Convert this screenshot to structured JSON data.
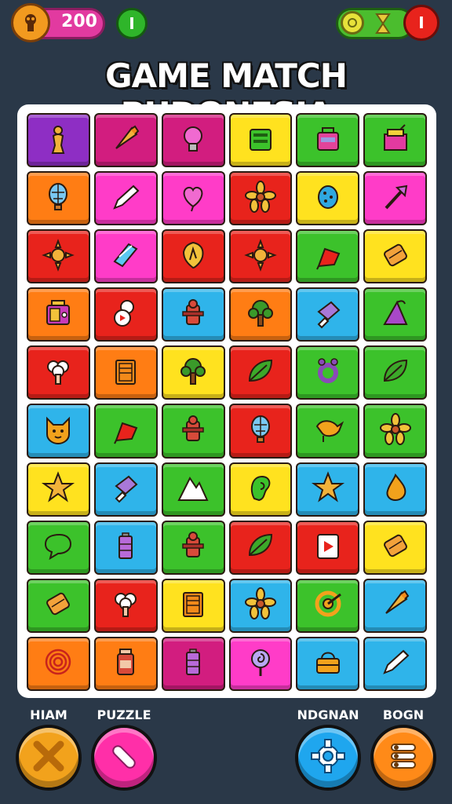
{
  "header": {
    "coins": "200",
    "left_info_label": "I",
    "right_info_label": "I"
  },
  "title": "GAME MATCH PUDONESIA",
  "colors": {
    "purple": "#8e2ec4",
    "magenta": "#d21d7f",
    "pink": "#ff3cc8",
    "yellow": "#ffe21f",
    "green": "#3cc22b",
    "orange": "#ff7d14",
    "red": "#e8231c",
    "blue": "#2fb4ea"
  },
  "board": {
    "rows": [
      [
        {
          "c": "purple",
          "i": "figure-icon"
        },
        {
          "c": "magenta",
          "i": "cone-icon"
        },
        {
          "c": "magenta",
          "i": "bulb-icon"
        },
        {
          "c": "yellow",
          "i": "machine-icon"
        },
        {
          "c": "green",
          "i": "bag-icon"
        },
        {
          "c": "green",
          "i": "box-icon"
        }
      ],
      [
        {
          "c": "orange",
          "i": "balloon-icon"
        },
        {
          "c": "pink",
          "i": "pencil-icon"
        },
        {
          "c": "pink",
          "i": "heart-icon"
        },
        {
          "c": "red",
          "i": "flower-icon"
        },
        {
          "c": "yellow",
          "i": "egg-icon"
        },
        {
          "c": "pink",
          "i": "arrow-icon"
        }
      ],
      [
        {
          "c": "red",
          "i": "sun-icon"
        },
        {
          "c": "pink",
          "i": "crystal-icon"
        },
        {
          "c": "red",
          "i": "shield-icon"
        },
        {
          "c": "red",
          "i": "sun-icon"
        },
        {
          "c": "green",
          "i": "flag-icon"
        },
        {
          "c": "yellow",
          "i": "scroll-icon"
        }
      ],
      [
        {
          "c": "orange",
          "i": "radio-icon"
        },
        {
          "c": "red",
          "i": "ball-icon"
        },
        {
          "c": "blue",
          "i": "hydrant-icon"
        },
        {
          "c": "orange",
          "i": "tree-icon"
        },
        {
          "c": "blue",
          "i": "flower-pot-icon"
        },
        {
          "c": "green",
          "i": "hat-icon"
        }
      ],
      [
        {
          "c": "red",
          "i": "mushroom-icon"
        },
        {
          "c": "orange",
          "i": "crate-icon"
        },
        {
          "c": "yellow",
          "i": "tree-icon"
        },
        {
          "c": "red",
          "i": "leaf-icon"
        },
        {
          "c": "green",
          "i": "ring-icon"
        },
        {
          "c": "green",
          "i": "leaf-icon"
        }
      ],
      [
        {
          "c": "blue",
          "i": "cat-icon"
        },
        {
          "c": "green",
          "i": "flag-icon"
        },
        {
          "c": "green",
          "i": "hydrant-icon"
        },
        {
          "c": "red",
          "i": "balloon-icon"
        },
        {
          "c": "green",
          "i": "bird-icon"
        },
        {
          "c": "green",
          "i": "flower-icon"
        }
      ],
      [
        {
          "c": "yellow",
          "i": "star-icon"
        },
        {
          "c": "blue",
          "i": "flower-pot-icon"
        },
        {
          "c": "green",
          "i": "mountain-icon"
        },
        {
          "c": "yellow",
          "i": "ear-icon"
        },
        {
          "c": "blue",
          "i": "star-icon"
        },
        {
          "c": "blue",
          "i": "drop-icon"
        }
      ],
      [
        {
          "c": "green",
          "i": "bubble-icon"
        },
        {
          "c": "blue",
          "i": "battery-icon"
        },
        {
          "c": "green",
          "i": "hydrant-icon"
        },
        {
          "c": "red",
          "i": "leaf-icon"
        },
        {
          "c": "red",
          "i": "play-icon"
        },
        {
          "c": "yellow",
          "i": "scroll-icon"
        }
      ],
      [
        {
          "c": "green",
          "i": "scroll-icon"
        },
        {
          "c": "red",
          "i": "mushroom-icon"
        },
        {
          "c": "yellow",
          "i": "crate-icon"
        },
        {
          "c": "blue",
          "i": "flower-icon"
        },
        {
          "c": "green",
          "i": "target-icon"
        },
        {
          "c": "blue",
          "i": "cone-icon"
        }
      ],
      [
        {
          "c": "orange",
          "i": "spiral-icon"
        },
        {
          "c": "orange",
          "i": "jar-icon"
        },
        {
          "c": "magenta",
          "i": "battery-icon"
        },
        {
          "c": "pink",
          "i": "lollipop-icon"
        },
        {
          "c": "blue",
          "i": "basket-icon"
        },
        {
          "c": "blue",
          "i": "pencil-icon"
        }
      ]
    ]
  },
  "bottom": {
    "buttons": [
      {
        "label": "HIAM",
        "icon": "close-icon",
        "color": "#f2a21c"
      },
      {
        "label": "PUZZLE",
        "icon": "wand-icon",
        "color": "#ff2fa8"
      },
      {
        "label": "NDGNAN",
        "icon": "gear-icon",
        "color": "#1fa6ee"
      },
      {
        "label": "BOGN",
        "icon": "menu-icon",
        "color": "#ff8a18"
      }
    ]
  }
}
